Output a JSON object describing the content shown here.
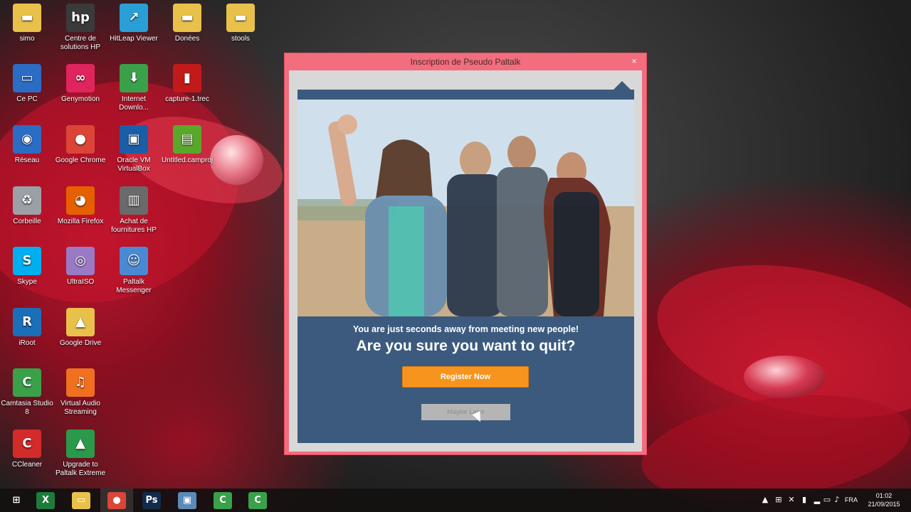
{
  "desktop_icons": [
    {
      "label": "simo",
      "icon": "folder-icon",
      "color": "#e9c14a"
    },
    {
      "label": "Centre de solutions HP",
      "icon": "hp-icon",
      "color": "#3a3a3a"
    },
    {
      "label": "HitLeap Viewer",
      "icon": "hitleap-icon",
      "color": "#2a9fd6"
    },
    {
      "label": "Donées",
      "icon": "folder-icon",
      "color": "#e9c14a"
    },
    {
      "label": "stools",
      "icon": "folder-icon",
      "color": "#e9c14a"
    },
    {
      "label": "Ce PC",
      "icon": "computer-icon",
      "color": "#2b6cc4"
    },
    {
      "label": "Genymotion",
      "icon": "genymotion-icon",
      "color": "#e0245e"
    },
    {
      "label": "Internet Downlo...",
      "icon": "idm-icon",
      "color": "#3aa14a"
    },
    {
      "label": "capture-1.trec",
      "icon": "trec-icon",
      "color": "#c21a1a"
    },
    {
      "label": "Réseau",
      "icon": "network-icon",
      "color": "#2b6cc4"
    },
    {
      "label": "Google Chrome",
      "icon": "chrome-icon",
      "color": "#db4437"
    },
    {
      "label": "Oracle VM VirtualBox",
      "icon": "virtualbox-icon",
      "color": "#1b5ea8"
    },
    {
      "label": "Untitled.camproj",
      "icon": "camproj-icon",
      "color": "#5aa82a"
    },
    {
      "label": "Corbeille",
      "icon": "recycle-bin-icon",
      "color": "#9aa0a6"
    },
    {
      "label": "Mozilla Firefox",
      "icon": "firefox-icon",
      "color": "#e66000"
    },
    {
      "label": "Achat de fournitures HP",
      "icon": "printer-icon",
      "color": "#6a6a6a"
    },
    {
      "label": "Skype",
      "icon": "skype-icon",
      "color": "#00aff0"
    },
    {
      "label": "UltraISO",
      "icon": "disc-icon",
      "color": "#9a7ac4"
    },
    {
      "label": "Paltalk Messenger",
      "icon": "paltalk-icon",
      "color": "#4a8ad4"
    },
    {
      "label": "iRoot",
      "icon": "iroot-icon",
      "color": "#1b6fb8"
    },
    {
      "label": "Google Drive",
      "icon": "google-drive-icon",
      "color": "#e9c14a"
    },
    {
      "label": "Camtasia Studio 8",
      "icon": "camtasia-icon",
      "color": "#3aa14a"
    },
    {
      "label": "Virtual Audio Streaming",
      "icon": "speaker-icon",
      "color": "#f07020"
    },
    {
      "label": "CCleaner",
      "icon": "ccleaner-icon",
      "color": "#d32a2a"
    },
    {
      "label": "Upgrade to Paltalk Extreme",
      "icon": "paltalk-extreme-icon",
      "color": "#2a9a4a"
    }
  ],
  "dialog": {
    "title": "Inscription de Pseudo Paltalk",
    "close": "×",
    "subheadline": "You are just seconds away from meeting new people!",
    "headline": "Are you sure you want to quit?",
    "register_label": "Register Now",
    "later_label": "Maybe Later",
    "accent": "#f7941d",
    "panel_color": "#3b5a7e"
  },
  "taskbar": {
    "items": [
      {
        "name": "windows-start-icon",
        "glyph": "⊞",
        "color": "transparent"
      },
      {
        "name": "excel-icon",
        "glyph": "X",
        "color": "#1e7b3c"
      },
      {
        "name": "file-explorer-icon",
        "glyph": "▭",
        "color": "#e9c14a"
      },
      {
        "name": "chrome-icon",
        "glyph": "●",
        "color": "#db4437"
      },
      {
        "name": "photoshop-icon",
        "glyph": "Ps",
        "color": "#0f2c4c"
      },
      {
        "name": "remote-desktop-icon",
        "glyph": "▣",
        "color": "#5a8ab8"
      },
      {
        "name": "camtasia-icon",
        "glyph": "C",
        "color": "#3aa14a"
      },
      {
        "name": "camtasia-recorder-icon",
        "glyph": "C",
        "color": "#3aa14a"
      }
    ],
    "language": "FRA",
    "time": "01:02",
    "date": "21/09/2015"
  }
}
